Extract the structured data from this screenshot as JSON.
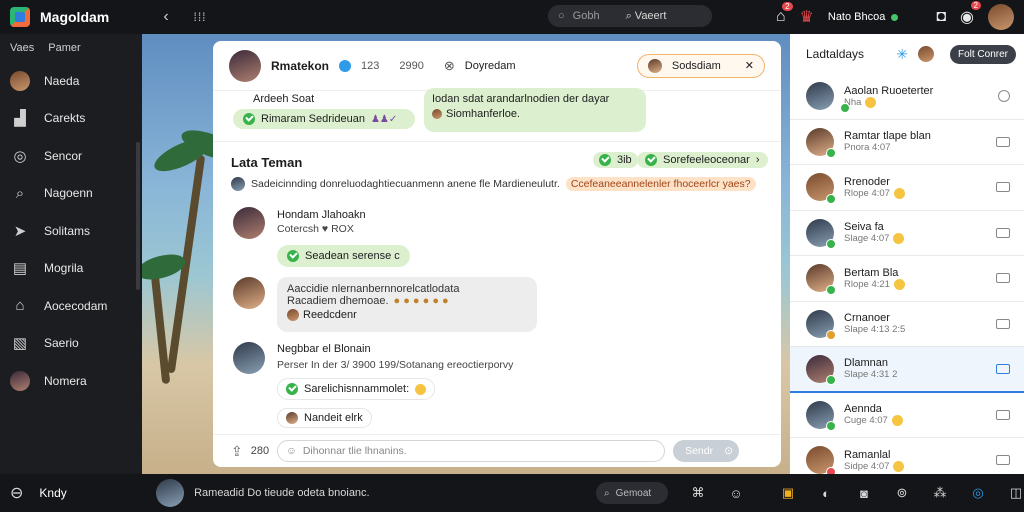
{
  "app": {
    "name": "Magoldam"
  },
  "topbar": {
    "back_icon": "back-arrow-icon",
    "grid_icon": "grid-icon",
    "search_placeholder": "Gobh",
    "search_button": "Vaeert",
    "home_badge": "2",
    "notification_badge": "2",
    "user_name": "Nato Bhcoa"
  },
  "sidebar": {
    "header": [
      "Vaes",
      "Pamer"
    ],
    "items": [
      {
        "label": "Naeda",
        "icon": "avatar-icon"
      },
      {
        "label": "Carekts",
        "icon": "chart-icon"
      },
      {
        "label": "Sencor",
        "icon": "compass-icon"
      },
      {
        "label": "Nagoenn",
        "icon": "search-icon"
      },
      {
        "label": "Solitams",
        "icon": "send-icon"
      },
      {
        "label": "Mogrila",
        "icon": "list-icon"
      },
      {
        "label": "Aocecodam",
        "icon": "home-icon"
      },
      {
        "label": "Saerio",
        "icon": "book-icon"
      },
      {
        "label": "Nomera",
        "icon": "avatar-icon"
      }
    ],
    "footer_label": "Kndy"
  },
  "card": {
    "header": {
      "name": "Rmatekon",
      "count": "123",
      "time": "2990",
      "channel": "Doyredam",
      "pill_label": "Sodsdiam",
      "pill_close": "✕"
    },
    "top_left_msg": {
      "title": "Ardeeh Soat",
      "green_text": "Rimaram Sedrideuan"
    },
    "top_right_msg": {
      "line1": "Iodan sdat arandarlnodien der dayar",
      "line2": "Siomhanferloe."
    },
    "section": {
      "title": "Lata Teman",
      "pill_small": "3ib",
      "pill_green": "Sorefeeleoceonar",
      "desc": "Sadeicinnding donreluodaghtiecuanmenn anene fle Mardieneulutr.",
      "desc_highlight": "Ccefeaneeannelenler fhoceerlcr yaes?"
    },
    "messages": [
      {
        "name": "Hondam Jlahoakn",
        "sub": "Cotercsh ♥ ROX",
        "pill": "Seadean serense c"
      },
      {
        "line1": "Aaccidie nlernanbernnorelcatlodata",
        "line2": "Racadiem dhemoae.",
        "tag": "Reedcdenr"
      },
      {
        "name": "Negbbar el Blonain",
        "sub": "Perser In der 3/ 3900 199/Sotanang ereoctierporvy",
        "pill": "Sarelichisnnammolet:",
        "tag": "Nandeit elrk"
      }
    ],
    "footer": {
      "count": "280",
      "input_placeholder": "Dihonnar tlie lhnanins.",
      "send_label": "Sendr"
    }
  },
  "right_panel": {
    "title": "Ladtaldays",
    "button": "Folt Conrer",
    "contacts": [
      {
        "name": "Aaolan Ruoeterter",
        "sub": "Nha"
      },
      {
        "name": "Ramtar tlape blan",
        "sub": "Pnora 4:07"
      },
      {
        "name": "Rrenoder",
        "sub": "Rlope 4:07"
      },
      {
        "name": "Seiva fa",
        "sub": "Slage 4:07"
      },
      {
        "name": "Bertam Bla",
        "sub": "Rlope 4:21"
      },
      {
        "name": "Crnanoer",
        "sub": "Slape 4:13 2:5"
      },
      {
        "name": "Dlamnan",
        "sub": "Slape 4:31 2"
      },
      {
        "name": "Aennda",
        "sub": "Cuge 4:07"
      },
      {
        "name": "Ramanlal",
        "sub": "Sidpe 4:07"
      }
    ]
  },
  "bottombar": {
    "status_text": "Rameadid Do tieude odeta bnoianc.",
    "search_label": "Gemoat"
  }
}
